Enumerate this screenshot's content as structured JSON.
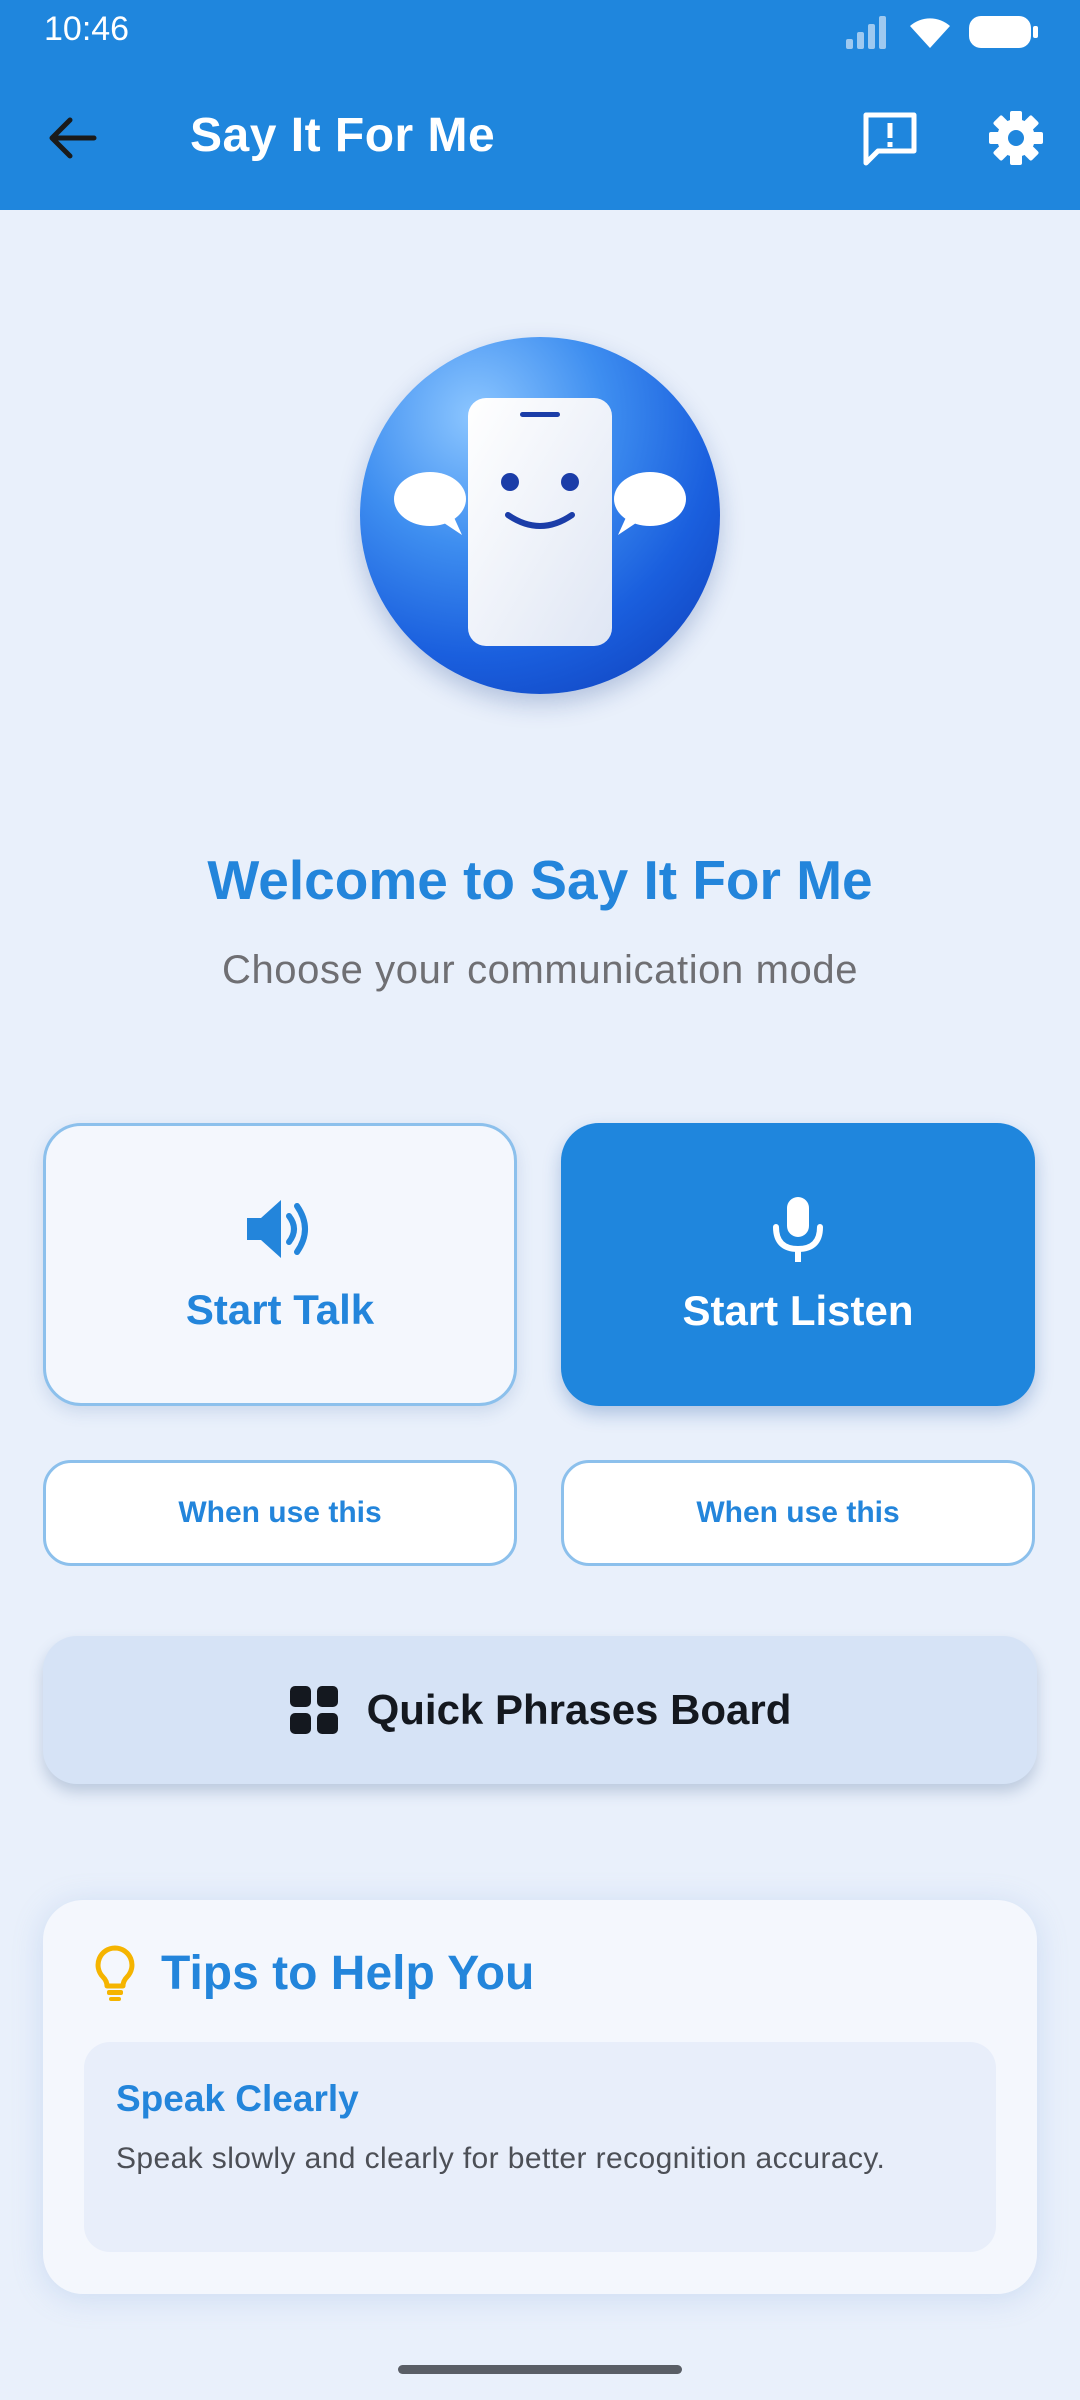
{
  "status_bar": {
    "time": "10:46"
  },
  "app_bar": {
    "title": "Say It For Me"
  },
  "hero": {
    "welcome_title": "Welcome to Say It For Me",
    "subtitle": "Choose your communication mode"
  },
  "modes": {
    "talk_label": "Start Talk",
    "listen_label": "Start Listen",
    "when_talk": "When use this",
    "when_listen": "When use this"
  },
  "quick_phrases": {
    "label": "Quick Phrases Board"
  },
  "tips": {
    "title": "Tips to Help You",
    "items": [
      {
        "title": "Speak Clearly",
        "text": "Speak slowly and clearly for better recognition accuracy."
      }
    ]
  },
  "colors": {
    "primary": "#1f86dd",
    "accent_text": "#2385db",
    "background": "#e9f0fb",
    "tip_icon": "#f5b400"
  },
  "icons": {
    "back": "arrow-back-icon",
    "feedback": "feedback-icon",
    "settings": "gear-icon",
    "talk": "speaker-icon",
    "listen": "microphone-icon",
    "quick": "grid-icon",
    "tips": "lightbulb-icon"
  }
}
